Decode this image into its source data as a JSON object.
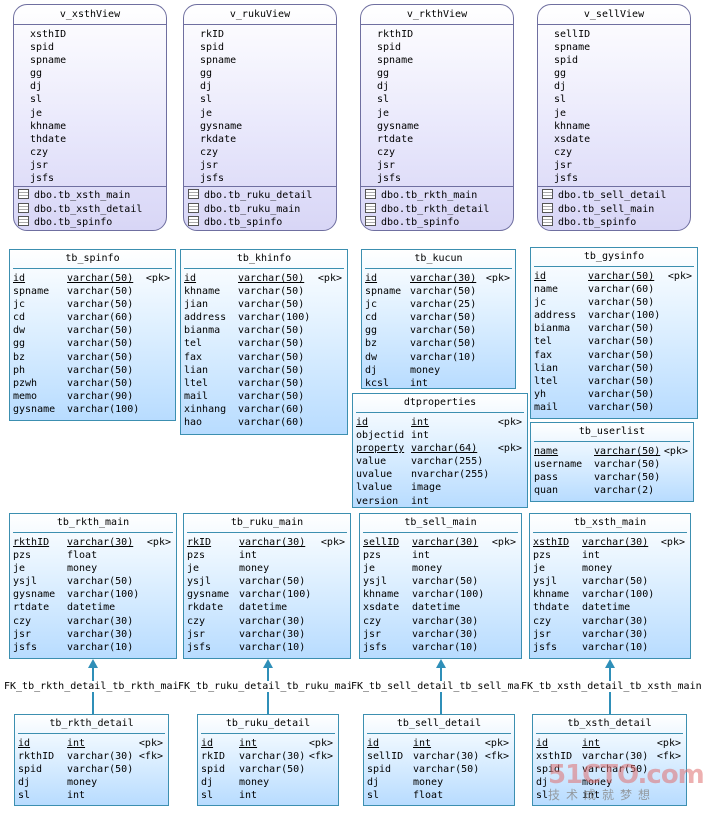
{
  "views": [
    {
      "name": "v_xsthView",
      "columns": [
        "xsthID",
        "spid",
        "spname",
        "gg",
        "dj",
        "sl",
        "je",
        "khname",
        "thdate",
        "czy",
        "jsr",
        "jsfs"
      ],
      "tables": [
        "dbo.tb_xsth_main",
        "dbo.tb_xsth_detail",
        "dbo.tb_spinfo"
      ]
    },
    {
      "name": "v_rukuView",
      "columns": [
        "rkID",
        "spid",
        "spname",
        "gg",
        "dj",
        "sl",
        "je",
        "gysname",
        "rkdate",
        "czy",
        "jsr",
        "jsfs"
      ],
      "tables": [
        "dbo.tb_ruku_detail",
        "dbo.tb_ruku_main",
        "dbo.tb_spinfo"
      ]
    },
    {
      "name": "v_rkthView",
      "columns": [
        "rkthID",
        "spid",
        "spname",
        "gg",
        "dj",
        "sl",
        "je",
        "gysname",
        "rtdate",
        "czy",
        "jsr",
        "jsfs"
      ],
      "tables": [
        "dbo.tb_rkth_main",
        "dbo.tb_rkth_detail",
        "dbo.tb_spinfo"
      ]
    },
    {
      "name": "v_sellView",
      "columns": [
        "sellID",
        "spname",
        "spid",
        "gg",
        "dj",
        "sl",
        "je",
        "khname",
        "xsdate",
        "czy",
        "jsr",
        "jsfs"
      ],
      "tables": [
        "dbo.tb_sell_detail",
        "dbo.tb_sell_main",
        "dbo.tb_spinfo"
      ]
    }
  ],
  "tables": [
    {
      "name": "tb_spinfo",
      "rows": [
        [
          "id",
          "varchar(50)",
          "<pk>",
          true
        ],
        [
          "spname",
          "varchar(50)",
          "",
          false
        ],
        [
          "jc",
          "varchar(50)",
          "",
          false
        ],
        [
          "cd",
          "varchar(60)",
          "",
          false
        ],
        [
          "dw",
          "varchar(50)",
          "",
          false
        ],
        [
          "gg",
          "varchar(50)",
          "",
          false
        ],
        [
          "bz",
          "varchar(50)",
          "",
          false
        ],
        [
          "ph",
          "varchar(50)",
          "",
          false
        ],
        [
          "pzwh",
          "varchar(50)",
          "",
          false
        ],
        [
          "memo",
          "varchar(90)",
          "",
          false
        ],
        [
          "gysname",
          "varchar(100)",
          "",
          false
        ]
      ]
    },
    {
      "name": "tb_khinfo",
      "rows": [
        [
          "id",
          "varchar(50)",
          "<pk>",
          true
        ],
        [
          "khname",
          "varchar(50)",
          "",
          false
        ],
        [
          "jian",
          "varchar(50)",
          "",
          false
        ],
        [
          "address",
          "varchar(100)",
          "",
          false
        ],
        [
          "bianma",
          "varchar(50)",
          "",
          false
        ],
        [
          "tel",
          "varchar(50)",
          "",
          false
        ],
        [
          "fax",
          "varchar(50)",
          "",
          false
        ],
        [
          "lian",
          "varchar(50)",
          "",
          false
        ],
        [
          "ltel",
          "varchar(50)",
          "",
          false
        ],
        [
          "mail",
          "varchar(50)",
          "",
          false
        ],
        [
          "xinhang",
          "varchar(60)",
          "",
          false
        ],
        [
          "hao",
          "varchar(60)",
          "",
          false
        ]
      ]
    },
    {
      "name": "tb_kucun",
      "rows": [
        [
          "id",
          "varchar(30)",
          "<pk>",
          true
        ],
        [
          "spname",
          "varchar(50)",
          "",
          false
        ],
        [
          "jc",
          "varchar(25)",
          "",
          false
        ],
        [
          "cd",
          "varchar(50)",
          "",
          false
        ],
        [
          "gg",
          "varchar(50)",
          "",
          false
        ],
        [
          "bz",
          "varchar(50)",
          "",
          false
        ],
        [
          "dw",
          "varchar(10)",
          "",
          false
        ],
        [
          "dj",
          "money",
          "",
          false
        ],
        [
          "kcsl",
          "int",
          "",
          false
        ]
      ]
    },
    {
      "name": "tb_gysinfo",
      "rows": [
        [
          "id",
          "varchar(50)",
          "<pk>",
          true
        ],
        [
          "name",
          "varchar(60)",
          "",
          false
        ],
        [
          "jc",
          "varchar(50)",
          "",
          false
        ],
        [
          "address",
          "varchar(100)",
          "",
          false
        ],
        [
          "bianma",
          "varchar(50)",
          "",
          false
        ],
        [
          "tel",
          "varchar(50)",
          "",
          false
        ],
        [
          "fax",
          "varchar(50)",
          "",
          false
        ],
        [
          "lian",
          "varchar(50)",
          "",
          false
        ],
        [
          "ltel",
          "varchar(50)",
          "",
          false
        ],
        [
          "yh",
          "varchar(50)",
          "",
          false
        ],
        [
          "mail",
          "varchar(50)",
          "",
          false
        ]
      ]
    },
    {
      "name": "dtproperties",
      "rows": [
        [
          "id",
          "int",
          "<pk>",
          true
        ],
        [
          "objectid",
          "int",
          "",
          false
        ],
        [
          "property",
          "varchar(64)",
          "<pk>",
          true
        ],
        [
          "value",
          "varchar(255)",
          "",
          false
        ],
        [
          "uvalue",
          "nvarchar(255)",
          "",
          false
        ],
        [
          "lvalue",
          "image",
          "",
          false
        ],
        [
          "version",
          "int",
          "",
          false
        ]
      ]
    },
    {
      "name": "tb_userlist",
      "rows": [
        [
          "name",
          "varchar(50)",
          "<pk>",
          true
        ],
        [
          "username",
          "varchar(50)",
          "",
          false
        ],
        [
          "pass",
          "varchar(50)",
          "",
          false
        ],
        [
          "quan",
          "varchar(2)",
          "",
          false
        ]
      ]
    },
    {
      "name": "tb_rkth_main",
      "rows": [
        [
          "rkthID",
          "varchar(30)",
          "<pk>",
          true
        ],
        [
          "pzs",
          "float",
          "",
          false
        ],
        [
          "je",
          "money",
          "",
          false
        ],
        [
          "ysjl",
          "varchar(50)",
          "",
          false
        ],
        [
          "gysname",
          "varchar(100)",
          "",
          false
        ],
        [
          "rtdate",
          "datetime",
          "",
          false
        ],
        [
          "czy",
          "varchar(30)",
          "",
          false
        ],
        [
          "jsr",
          "varchar(30)",
          "",
          false
        ],
        [
          "jsfs",
          "varchar(10)",
          "",
          false
        ]
      ]
    },
    {
      "name": "tb_ruku_main",
      "rows": [
        [
          "rkID",
          "varchar(30)",
          "<pk>",
          true
        ],
        [
          "pzs",
          "int",
          "",
          false
        ],
        [
          "je",
          "money",
          "",
          false
        ],
        [
          "ysjl",
          "varchar(50)",
          "",
          false
        ],
        [
          "gysname",
          "varchar(100)",
          "",
          false
        ],
        [
          "rkdate",
          "datetime",
          "",
          false
        ],
        [
          "czy",
          "varchar(30)",
          "",
          false
        ],
        [
          "jsr",
          "varchar(30)",
          "",
          false
        ],
        [
          "jsfs",
          "varchar(10)",
          "",
          false
        ]
      ]
    },
    {
      "name": "tb_sell_main",
      "rows": [
        [
          "sellID",
          "varchar(30)",
          "<pk>",
          true
        ],
        [
          "pzs",
          "int",
          "",
          false
        ],
        [
          "je",
          "money",
          "",
          false
        ],
        [
          "ysjl",
          "varchar(50)",
          "",
          false
        ],
        [
          "khname",
          "varchar(100)",
          "",
          false
        ],
        [
          "xsdate",
          "datetime",
          "",
          false
        ],
        [
          "czy",
          "varchar(30)",
          "",
          false
        ],
        [
          "jsr",
          "varchar(30)",
          "",
          false
        ],
        [
          "jsfs",
          "varchar(10)",
          "",
          false
        ]
      ]
    },
    {
      "name": "tb_xsth_main",
      "rows": [
        [
          "xsthID",
          "varchar(30)",
          "<pk>",
          true
        ],
        [
          "pzs",
          "int",
          "",
          false
        ],
        [
          "je",
          "money",
          "",
          false
        ],
        [
          "ysjl",
          "varchar(50)",
          "",
          false
        ],
        [
          "khname",
          "varchar(100)",
          "",
          false
        ],
        [
          "thdate",
          "datetime",
          "",
          false
        ],
        [
          "czy",
          "varchar(30)",
          "",
          false
        ],
        [
          "jsr",
          "varchar(30)",
          "",
          false
        ],
        [
          "jsfs",
          "varchar(10)",
          "",
          false
        ]
      ]
    },
    {
      "name": "tb_rkth_detail",
      "rows": [
        [
          "id",
          "int",
          "<pk>",
          true
        ],
        [
          "rkthID",
          "varchar(30)",
          "<fk>",
          false
        ],
        [
          "spid",
          "varchar(50)",
          "",
          false
        ],
        [
          "dj",
          "money",
          "",
          false
        ],
        [
          "sl",
          "int",
          "",
          false
        ]
      ]
    },
    {
      "name": "tb_ruku_detail",
      "rows": [
        [
          "id",
          "int",
          "<pk>",
          true
        ],
        [
          "rkID",
          "varchar(30)",
          "<fk>",
          false
        ],
        [
          "spid",
          "varchar(50)",
          "",
          false
        ],
        [
          "dj",
          "money",
          "",
          false
        ],
        [
          "sl",
          "int",
          "",
          false
        ]
      ]
    },
    {
      "name": "tb_sell_detail",
      "rows": [
        [
          "id",
          "int",
          "<pk>",
          true
        ],
        [
          "sellID",
          "varchar(30)",
          "<fk>",
          false
        ],
        [
          "spid",
          "varchar(50)",
          "",
          false
        ],
        [
          "dj",
          "money",
          "",
          false
        ],
        [
          "sl",
          "float",
          "",
          false
        ]
      ]
    },
    {
      "name": "tb_xsth_detail",
      "rows": [
        [
          "id",
          "int",
          "<pk>",
          true
        ],
        [
          "xsthID",
          "varchar(30)",
          "<fk>",
          false
        ],
        [
          "spid",
          "varchar(50)",
          "",
          false
        ],
        [
          "dj",
          "money",
          "",
          false
        ],
        [
          "sl",
          "int",
          "",
          false
        ]
      ]
    }
  ],
  "fk_labels": [
    "FK_tb_rkth_detail_tb_rkth_main",
    "FK_tb_ruku_detail_tb_ruku_main",
    "FK_tb_sell_detail_tb_sell_main",
    "FK_tb_xsth_detail_tb_xsth_main"
  ],
  "watermark": {
    "line1": "51CTO.com",
    "line2": "技术成就梦想"
  }
}
